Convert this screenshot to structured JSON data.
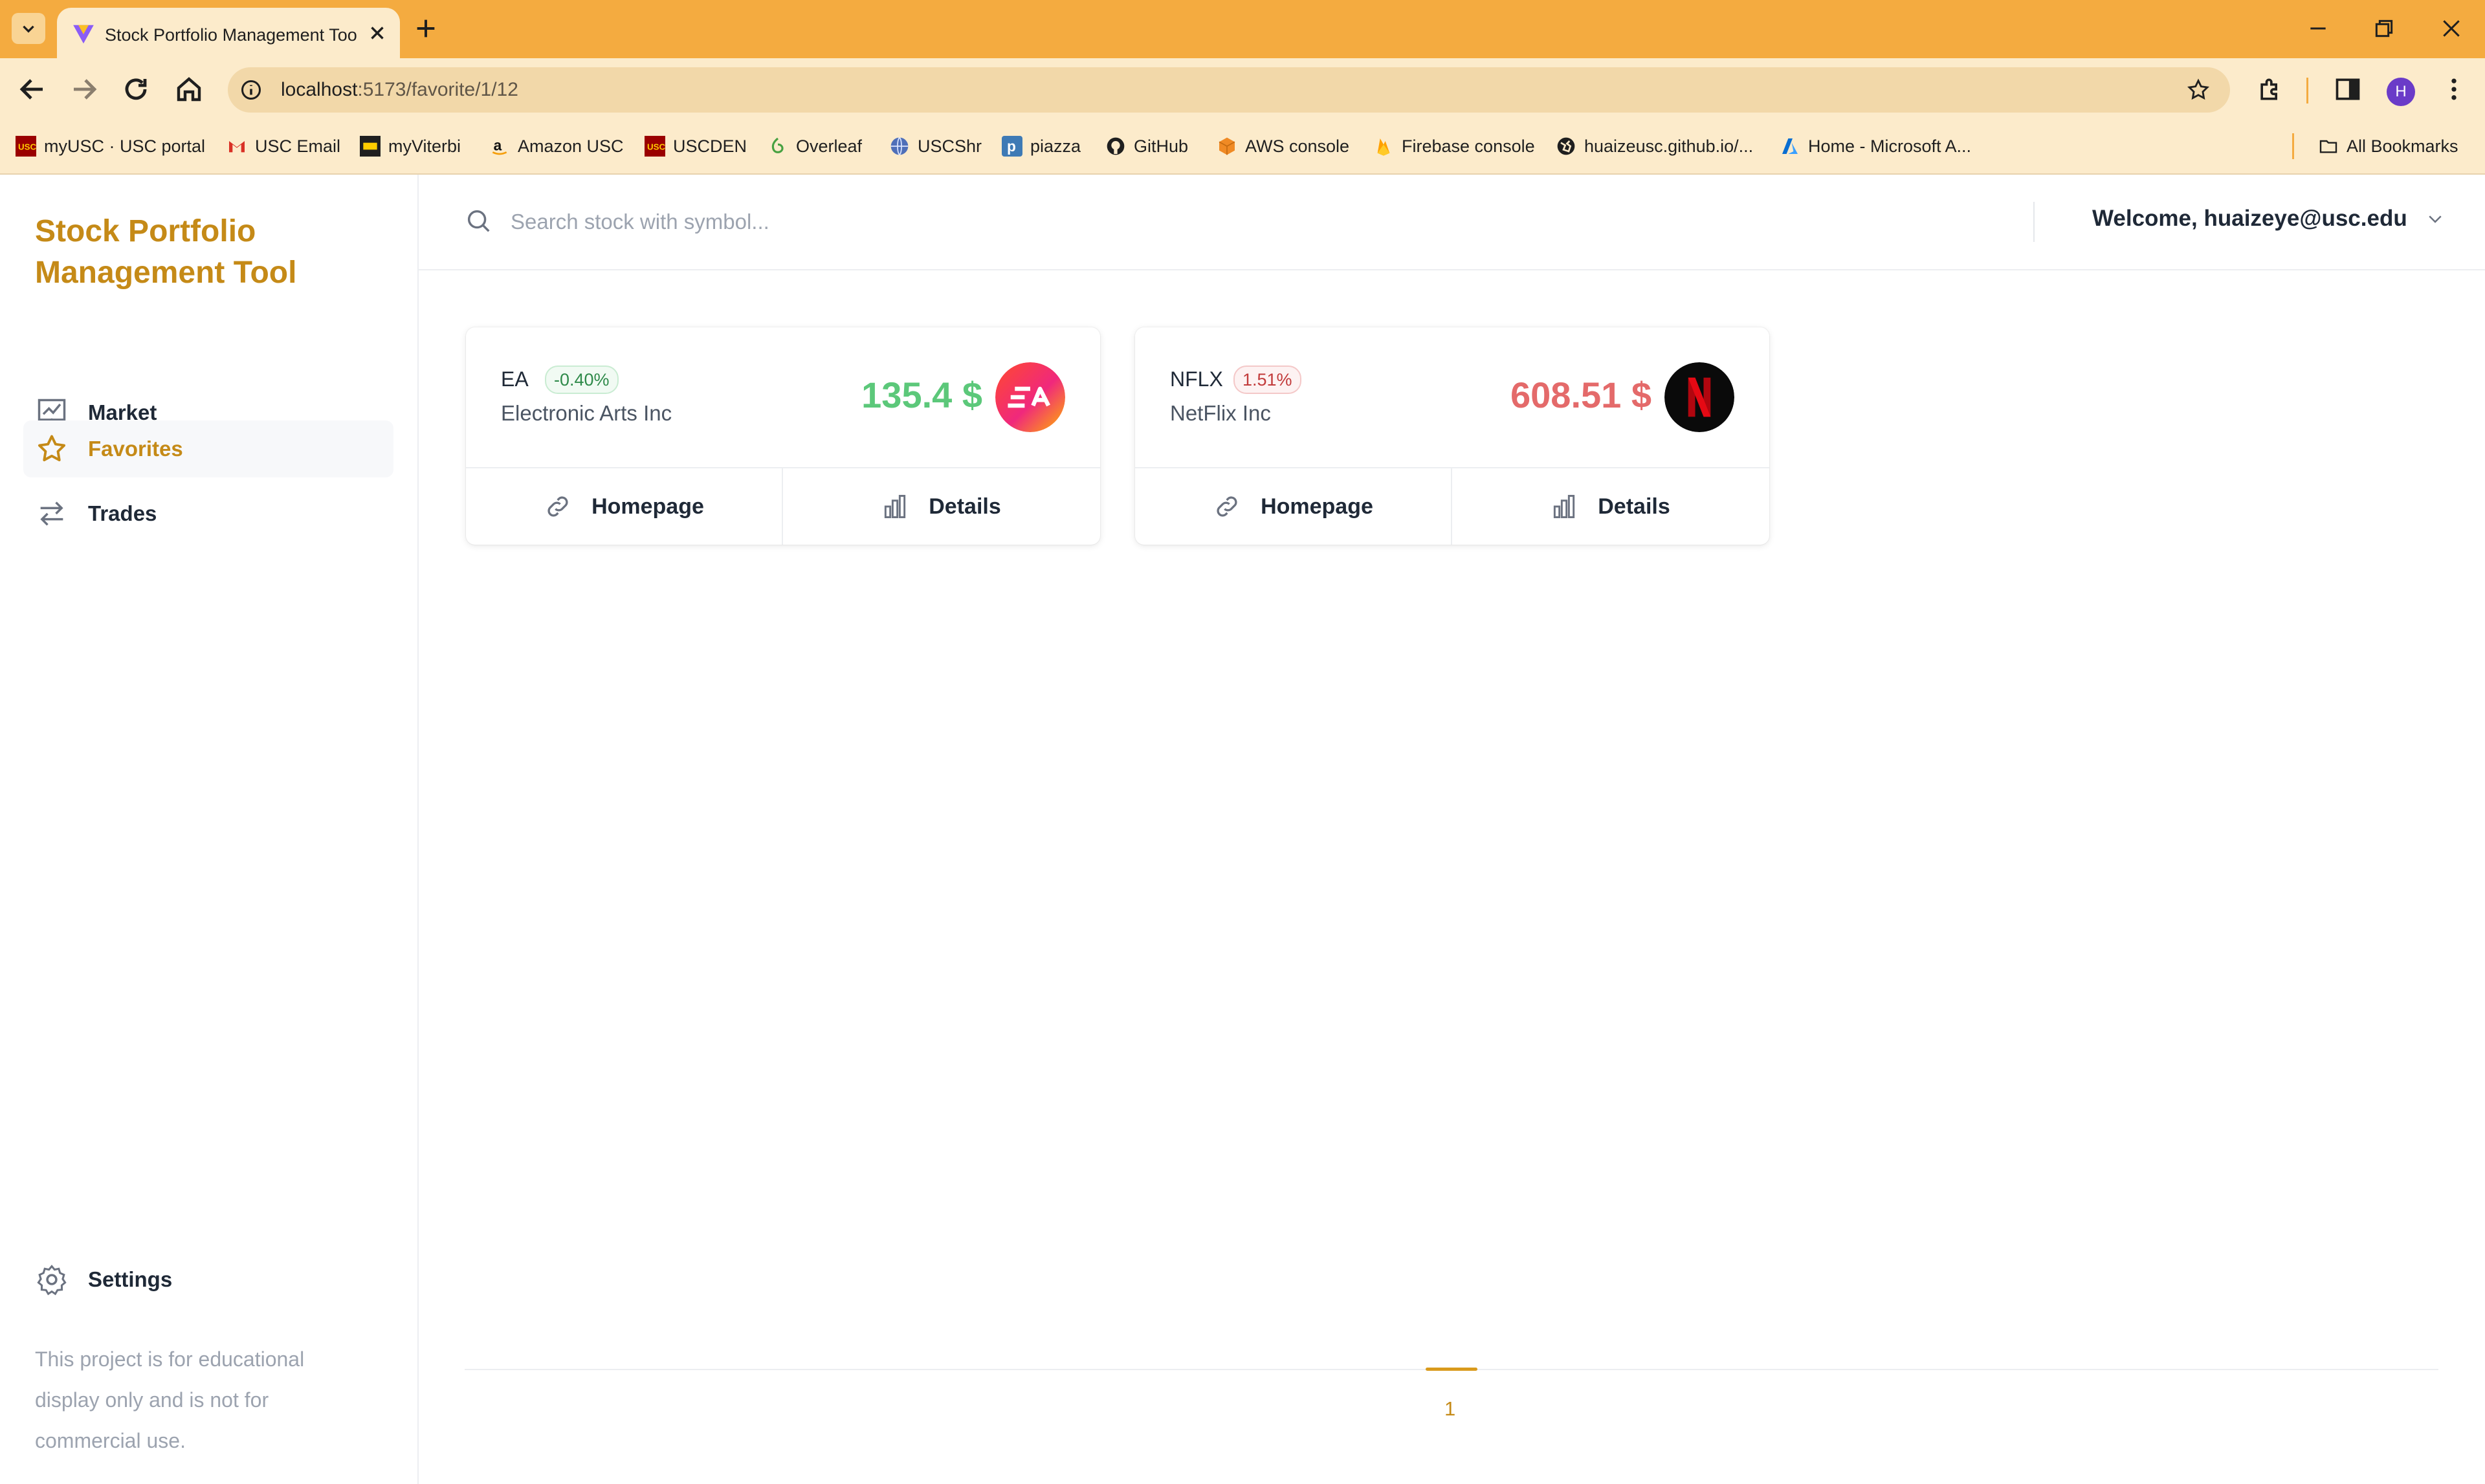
{
  "browser": {
    "tab_title": "Stock Portfolio Management Tool",
    "url_host": "localhost",
    "url_path": ":5173/favorite/1/12",
    "profile_initial": "H",
    "bookmarks": [
      {
        "label": "myUSC · USC portal",
        "icon": "usc-icon"
      },
      {
        "label": "USC Email",
        "icon": "gmail-icon"
      },
      {
        "label": "myViterbi",
        "icon": "viterbi-icon"
      },
      {
        "label": "Amazon USC",
        "icon": "amazon-icon"
      },
      {
        "label": "USCDEN",
        "icon": "usc-icon"
      },
      {
        "label": "Overleaf",
        "icon": "overleaf-icon"
      },
      {
        "label": "USCShr",
        "icon": "globe-icon"
      },
      {
        "label": "piazza",
        "icon": "piazza-icon"
      },
      {
        "label": "GitHub",
        "icon": "github-icon"
      },
      {
        "label": "AWS console",
        "icon": "aws-icon"
      },
      {
        "label": "Firebase console",
        "icon": "firebase-icon"
      },
      {
        "label": "huaizeusc.github.io/...",
        "icon": "globe-icon"
      },
      {
        "label": "Home - Microsoft A...",
        "icon": "azure-icon"
      }
    ],
    "all_bookmarks_label": "All Bookmarks"
  },
  "app": {
    "title": "Stock Portfolio Management Tool",
    "nav": [
      {
        "label": "Market",
        "icon": "chart-board-icon",
        "active": false
      },
      {
        "label": "Favorites",
        "icon": "star-icon",
        "active": true
      },
      {
        "label": "Trades",
        "icon": "swap-arrows-icon",
        "active": false
      }
    ],
    "settings_label": "Settings",
    "disclaimer": "This project is for educational display only and is not for commercial use."
  },
  "header": {
    "search_placeholder": "Search stock with symbol...",
    "welcome": "Welcome, huaizeye@usc.edu"
  },
  "cards": [
    {
      "symbol": "EA",
      "change": "-0.40%",
      "company": "Electronic Arts Inc",
      "price": "135.4 $",
      "trend": "down",
      "homepage_label": "Homepage",
      "details_label": "Details",
      "logo": "ea-logo"
    },
    {
      "symbol": "NFLX",
      "change": "1.51%",
      "company": "NetFlix Inc",
      "price": "608.51 $",
      "trend": "up",
      "homepage_label": "Homepage",
      "details_label": "Details",
      "logo": "netflix-logo"
    }
  ],
  "pagination": {
    "current_page": "1"
  },
  "colors": {
    "browser_accent": "#f4ab40",
    "brand": "#c58a17",
    "up_green": "#5cc87a",
    "down_red": "#e46a6a"
  }
}
